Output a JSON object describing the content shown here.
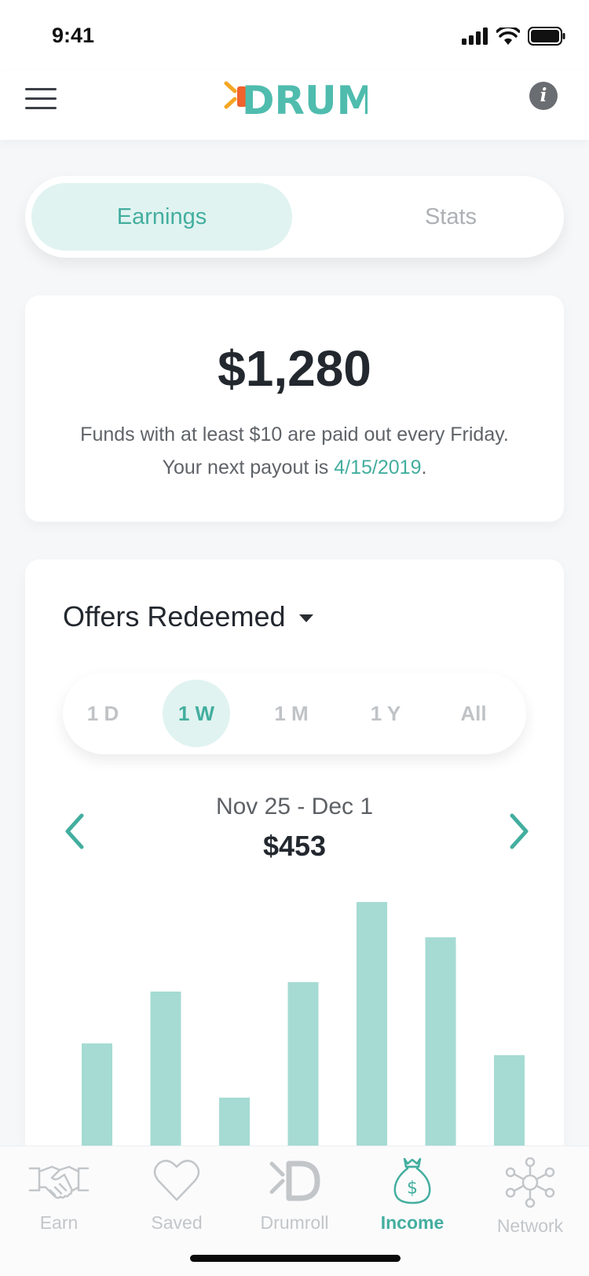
{
  "status_bar": {
    "time": "9:41"
  },
  "header": {
    "logo_text": "DRUM",
    "menu_icon": "hamburger-icon",
    "info_icon": "info-icon",
    "info_glyph": "i"
  },
  "segment": {
    "tabs": [
      {
        "label": "Earnings",
        "active": true
      },
      {
        "label": "Stats",
        "active": false
      }
    ]
  },
  "balance": {
    "amount": "$1,280",
    "note_prefix": "Funds with at least $10 are paid out every Friday. Your next payout is ",
    "payout_date": "4/15/2019",
    "note_suffix": "."
  },
  "chart_panel": {
    "title": "Offers Redeemed",
    "ranges": [
      {
        "label": "1 D",
        "active": false
      },
      {
        "label": "1 W",
        "active": true
      },
      {
        "label": "1 M",
        "active": false
      },
      {
        "label": "1 Y",
        "active": false
      },
      {
        "label": "All",
        "active": false
      }
    ],
    "period_label": "Nov 25 - Dec 1",
    "period_amount": "$453"
  },
  "chart_data": {
    "type": "bar",
    "categories": [
      "",
      "",
      "",
      "",
      "",
      "",
      ""
    ],
    "values": [
      48,
      70,
      25,
      74,
      108,
      93,
      43
    ],
    "ylim": [
      0,
      110
    ],
    "grid": false,
    "color": "#a5dbd3"
  },
  "tabbar": {
    "items": [
      {
        "label": "Earn",
        "icon": "handshake-icon",
        "active": false
      },
      {
        "label": "Saved",
        "icon": "heart-icon",
        "active": false
      },
      {
        "label": "Drumroll",
        "icon": "drum-logo-icon",
        "active": false
      },
      {
        "label": "Income",
        "icon": "money-bag-icon",
        "active": true
      },
      {
        "label": "Network",
        "icon": "network-icon",
        "active": false
      }
    ]
  },
  "colors": {
    "accent": "#43ae9f",
    "accent_light": "#e0f3f0",
    "bar": "#a5dbd3",
    "logo_orange": "#f0632d"
  }
}
